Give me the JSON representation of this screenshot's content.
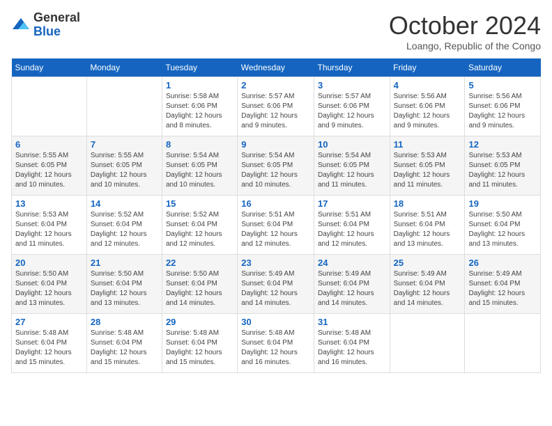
{
  "header": {
    "logo_general": "General",
    "logo_blue": "Blue",
    "month_title": "October 2024",
    "location": "Loango, Republic of the Congo"
  },
  "days_of_week": [
    "Sunday",
    "Monday",
    "Tuesday",
    "Wednesday",
    "Thursday",
    "Friday",
    "Saturday"
  ],
  "weeks": [
    [
      {
        "day": "",
        "info": ""
      },
      {
        "day": "",
        "info": ""
      },
      {
        "day": "1",
        "info": "Sunrise: 5:58 AM\nSunset: 6:06 PM\nDaylight: 12 hours\nand 8 minutes."
      },
      {
        "day": "2",
        "info": "Sunrise: 5:57 AM\nSunset: 6:06 PM\nDaylight: 12 hours\nand 9 minutes."
      },
      {
        "day": "3",
        "info": "Sunrise: 5:57 AM\nSunset: 6:06 PM\nDaylight: 12 hours\nand 9 minutes."
      },
      {
        "day": "4",
        "info": "Sunrise: 5:56 AM\nSunset: 6:06 PM\nDaylight: 12 hours\nand 9 minutes."
      },
      {
        "day": "5",
        "info": "Sunrise: 5:56 AM\nSunset: 6:06 PM\nDaylight: 12 hours\nand 9 minutes."
      }
    ],
    [
      {
        "day": "6",
        "info": "Sunrise: 5:55 AM\nSunset: 6:05 PM\nDaylight: 12 hours\nand 10 minutes."
      },
      {
        "day": "7",
        "info": "Sunrise: 5:55 AM\nSunset: 6:05 PM\nDaylight: 12 hours\nand 10 minutes."
      },
      {
        "day": "8",
        "info": "Sunrise: 5:54 AM\nSunset: 6:05 PM\nDaylight: 12 hours\nand 10 minutes."
      },
      {
        "day": "9",
        "info": "Sunrise: 5:54 AM\nSunset: 6:05 PM\nDaylight: 12 hours\nand 10 minutes."
      },
      {
        "day": "10",
        "info": "Sunrise: 5:54 AM\nSunset: 6:05 PM\nDaylight: 12 hours\nand 11 minutes."
      },
      {
        "day": "11",
        "info": "Sunrise: 5:53 AM\nSunset: 6:05 PM\nDaylight: 12 hours\nand 11 minutes."
      },
      {
        "day": "12",
        "info": "Sunrise: 5:53 AM\nSunset: 6:05 PM\nDaylight: 12 hours\nand 11 minutes."
      }
    ],
    [
      {
        "day": "13",
        "info": "Sunrise: 5:53 AM\nSunset: 6:04 PM\nDaylight: 12 hours\nand 11 minutes."
      },
      {
        "day": "14",
        "info": "Sunrise: 5:52 AM\nSunset: 6:04 PM\nDaylight: 12 hours\nand 12 minutes."
      },
      {
        "day": "15",
        "info": "Sunrise: 5:52 AM\nSunset: 6:04 PM\nDaylight: 12 hours\nand 12 minutes."
      },
      {
        "day": "16",
        "info": "Sunrise: 5:51 AM\nSunset: 6:04 PM\nDaylight: 12 hours\nand 12 minutes."
      },
      {
        "day": "17",
        "info": "Sunrise: 5:51 AM\nSunset: 6:04 PM\nDaylight: 12 hours\nand 12 minutes."
      },
      {
        "day": "18",
        "info": "Sunrise: 5:51 AM\nSunset: 6:04 PM\nDaylight: 12 hours\nand 13 minutes."
      },
      {
        "day": "19",
        "info": "Sunrise: 5:50 AM\nSunset: 6:04 PM\nDaylight: 12 hours\nand 13 minutes."
      }
    ],
    [
      {
        "day": "20",
        "info": "Sunrise: 5:50 AM\nSunset: 6:04 PM\nDaylight: 12 hours\nand 13 minutes."
      },
      {
        "day": "21",
        "info": "Sunrise: 5:50 AM\nSunset: 6:04 PM\nDaylight: 12 hours\nand 13 minutes."
      },
      {
        "day": "22",
        "info": "Sunrise: 5:50 AM\nSunset: 6:04 PM\nDaylight: 12 hours\nand 14 minutes."
      },
      {
        "day": "23",
        "info": "Sunrise: 5:49 AM\nSunset: 6:04 PM\nDaylight: 12 hours\nand 14 minutes."
      },
      {
        "day": "24",
        "info": "Sunrise: 5:49 AM\nSunset: 6:04 PM\nDaylight: 12 hours\nand 14 minutes."
      },
      {
        "day": "25",
        "info": "Sunrise: 5:49 AM\nSunset: 6:04 PM\nDaylight: 12 hours\nand 14 minutes."
      },
      {
        "day": "26",
        "info": "Sunrise: 5:49 AM\nSunset: 6:04 PM\nDaylight: 12 hours\nand 15 minutes."
      }
    ],
    [
      {
        "day": "27",
        "info": "Sunrise: 5:48 AM\nSunset: 6:04 PM\nDaylight: 12 hours\nand 15 minutes."
      },
      {
        "day": "28",
        "info": "Sunrise: 5:48 AM\nSunset: 6:04 PM\nDaylight: 12 hours\nand 15 minutes."
      },
      {
        "day": "29",
        "info": "Sunrise: 5:48 AM\nSunset: 6:04 PM\nDaylight: 12 hours\nand 15 minutes."
      },
      {
        "day": "30",
        "info": "Sunrise: 5:48 AM\nSunset: 6:04 PM\nDaylight: 12 hours\nand 16 minutes."
      },
      {
        "day": "31",
        "info": "Sunrise: 5:48 AM\nSunset: 6:04 PM\nDaylight: 12 hours\nand 16 minutes."
      },
      {
        "day": "",
        "info": ""
      },
      {
        "day": "",
        "info": ""
      }
    ]
  ]
}
